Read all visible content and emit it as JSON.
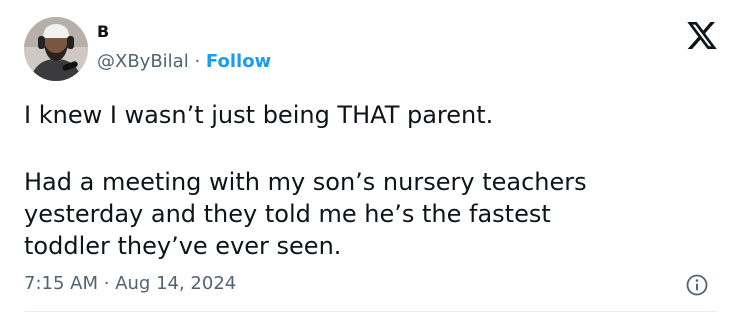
{
  "author": {
    "name": "B",
    "handle": "@XByBilal",
    "separator": "·",
    "follow_label": "Follow"
  },
  "icons": {
    "brand": "x-logo-icon",
    "info": "info-icon",
    "avatar": "avatar-image"
  },
  "tweet": {
    "lines": [
      "I knew I wasn’t just being THAT parent.",
      "Had a meeting with my son’s nursery teachers",
      "yesterday and they told me he’s the fastest",
      "toddler they’ve ever seen."
    ]
  },
  "meta": {
    "time": "7:15 AM",
    "separator": "·",
    "date": "Aug 14, 2024"
  },
  "colors": {
    "text": "#0f1419",
    "secondary": "#536471",
    "accent": "#1d9bf0"
  }
}
